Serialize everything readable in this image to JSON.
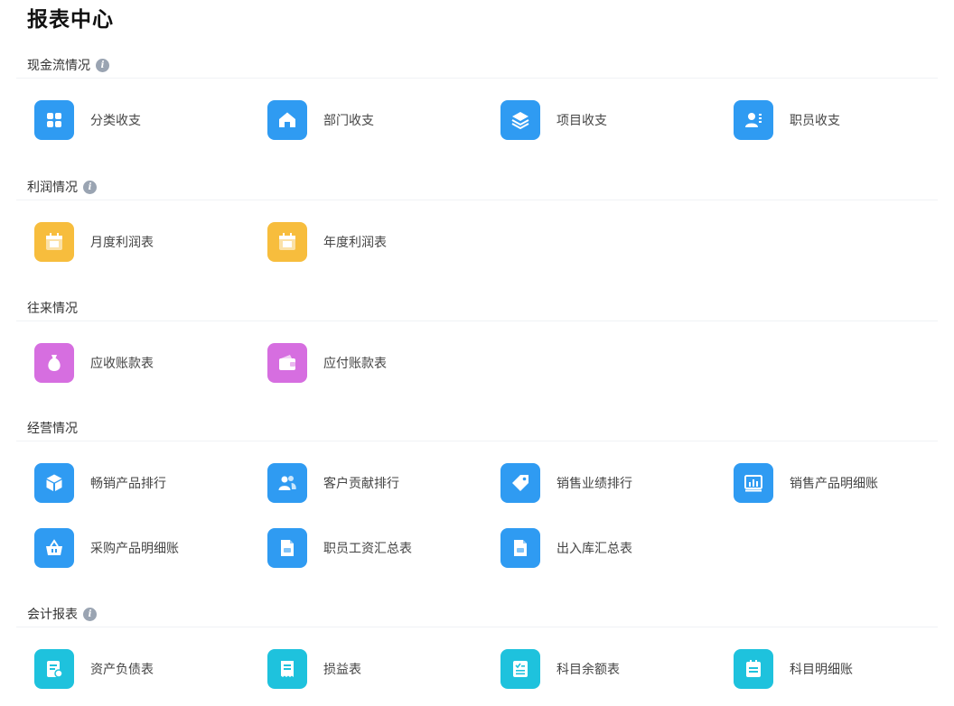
{
  "page": {
    "title": "报表中心"
  },
  "colors": {
    "blue": "#2f9bf2",
    "yellow": "#f7bd3d",
    "purple": "#d66ee0",
    "teal": "#1ec2dd"
  },
  "sections": [
    {
      "title": "现金流情况",
      "info": true,
      "rows": [
        [
          {
            "label": "分类收支",
            "icon": "grid-icon",
            "color": "blue"
          },
          {
            "label": "部门收支",
            "icon": "home-icon",
            "color": "blue"
          },
          {
            "label": "项目收支",
            "icon": "layers-icon",
            "color": "blue"
          },
          {
            "label": "职员收支",
            "icon": "person-card-icon",
            "color": "blue"
          }
        ]
      ]
    },
    {
      "title": "利润情况",
      "info": true,
      "rows": [
        [
          {
            "label": "月度利润表",
            "icon": "calendar-icon",
            "color": "yellow"
          },
          {
            "label": "年度利润表",
            "icon": "calendar-icon",
            "color": "yellow"
          }
        ]
      ]
    },
    {
      "title": "往来情况",
      "info": false,
      "rows": [
        [
          {
            "label": "应收账款表",
            "icon": "money-bag-icon",
            "color": "purple"
          },
          {
            "label": "应付账款表",
            "icon": "wallet-icon",
            "color": "purple"
          }
        ]
      ]
    },
    {
      "title": "经营情况",
      "info": false,
      "rows": [
        [
          {
            "label": "畅销产品排行",
            "icon": "box-icon",
            "color": "blue"
          },
          {
            "label": "客户贡献排行",
            "icon": "users-icon",
            "color": "blue"
          },
          {
            "label": "销售业绩排行",
            "icon": "tag-icon",
            "color": "blue"
          },
          {
            "label": "销售产品明细账",
            "icon": "bar-chart-icon",
            "color": "blue"
          }
        ],
        [
          {
            "label": "采购产品明细账",
            "icon": "basket-icon",
            "color": "blue"
          },
          {
            "label": "职员工资汇总表",
            "icon": "document-icon",
            "color": "blue"
          },
          {
            "label": "出入库汇总表",
            "icon": "document-icon",
            "color": "blue"
          }
        ]
      ]
    },
    {
      "title": "会计报表",
      "info": true,
      "rows": [
        [
          {
            "label": "资产负债表",
            "icon": "balance-sheet-icon",
            "color": "teal"
          },
          {
            "label": "损益表",
            "icon": "receipt-icon",
            "color": "teal"
          },
          {
            "label": "科目余额表",
            "icon": "ledger-icon",
            "color": "teal"
          },
          {
            "label": "科目明细账",
            "icon": "list-icon",
            "color": "teal"
          }
        ]
      ]
    }
  ]
}
